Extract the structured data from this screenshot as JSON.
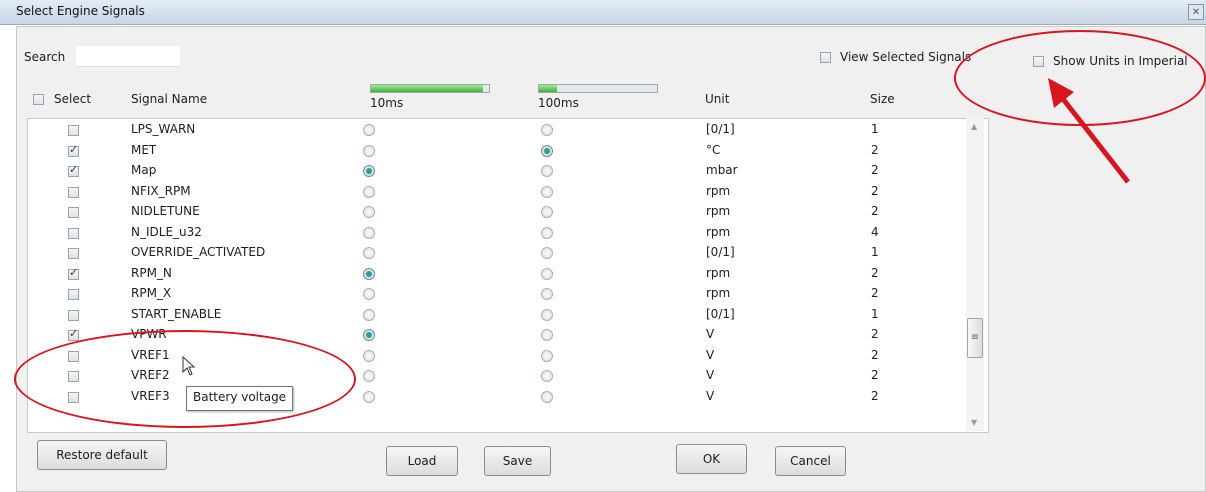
{
  "window": {
    "title": "Select Engine Signals",
    "close_icon": "close-icon"
  },
  "search": {
    "label": "Search",
    "value": ""
  },
  "options": {
    "view_selected_label": "View Selected Signals",
    "view_selected_checked": false,
    "imperial_label": "Show Units in Imperial",
    "imperial_checked": false
  },
  "table": {
    "headers": {
      "select": "Select",
      "signal_name": "Signal Name",
      "rate_10ms": "10ms",
      "rate_100ms": "100ms",
      "unit": "Unit",
      "size": "Size"
    },
    "select_all_checked": false,
    "load_10ms": 0.95,
    "load_100ms": 0.15,
    "rows": [
      {
        "checked": false,
        "name": "LPS_WARN",
        "rate": "",
        "unit": "[0/1]",
        "size": "1"
      },
      {
        "checked": true,
        "name": "MET",
        "rate": "100ms",
        "unit": "°C",
        "size": "2"
      },
      {
        "checked": true,
        "name": "Map",
        "rate": "10ms",
        "unit": "mbar",
        "size": "2"
      },
      {
        "checked": false,
        "name": "NFIX_RPM",
        "rate": "",
        "unit": "rpm",
        "size": "2"
      },
      {
        "checked": false,
        "name": "NIDLETUNE",
        "rate": "",
        "unit": "rpm",
        "size": "2"
      },
      {
        "checked": false,
        "name": "N_IDLE_u32",
        "rate": "",
        "unit": "rpm",
        "size": "4"
      },
      {
        "checked": false,
        "name": "OVERRIDE_ACTIVATED",
        "rate": "",
        "unit": "[0/1]",
        "size": "1"
      },
      {
        "checked": true,
        "name": "RPM_N",
        "rate": "10ms",
        "unit": "rpm",
        "size": "2"
      },
      {
        "checked": false,
        "name": "RPM_X",
        "rate": "",
        "unit": "rpm",
        "size": "2"
      },
      {
        "checked": false,
        "name": "START_ENABLE",
        "rate": "",
        "unit": "[0/1]",
        "size": "1"
      },
      {
        "checked": true,
        "name": "VPWR",
        "rate": "10ms",
        "unit": "V",
        "size": "2"
      },
      {
        "checked": false,
        "name": "VREF1",
        "rate": "",
        "unit": "V",
        "size": "2"
      },
      {
        "checked": false,
        "name": "VREF2",
        "rate": "",
        "unit": "V",
        "size": "2"
      },
      {
        "checked": false,
        "name": "VREF3",
        "rate": "",
        "unit": "V",
        "size": "2"
      }
    ]
  },
  "tooltip": {
    "text": "Battery voltage"
  },
  "buttons": {
    "restore": "Restore default",
    "load": "Load",
    "save": "Save",
    "ok": "OK",
    "cancel": "Cancel"
  },
  "annotation_color": "#d8141c",
  "accent_colors": {
    "progress": "#3cb43c",
    "radio_selected": "#2e9a9a"
  }
}
